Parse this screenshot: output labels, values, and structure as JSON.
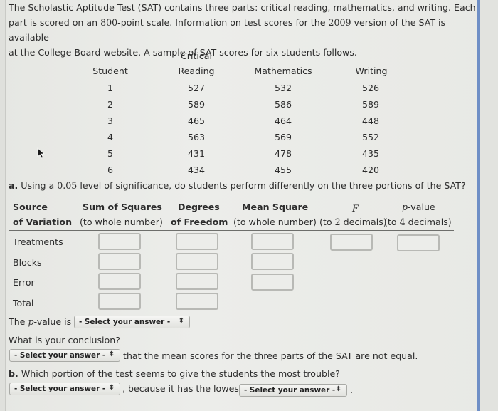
{
  "intro": {
    "line1": "The Scholastic Aptitude Test (SAT) contains three parts: critical reading, mathematics, and writing. Each",
    "line2_a": "part is scored on an ",
    "line2_num": "800",
    "line2_b": "-point scale. Information on test scores for the ",
    "line2_year": "2009",
    "line2_c": " version of the SAT is available",
    "line3": "at the College Board website. A sample of SAT scores for six students follows."
  },
  "scores_table": {
    "headers": {
      "student": "Student",
      "reading_top": "Critical",
      "reading_bottom": "Reading",
      "math": "Mathematics",
      "writing": "Writing"
    },
    "rows": [
      {
        "student": "1",
        "reading": "527",
        "math": "532",
        "writing": "526"
      },
      {
        "student": "2",
        "reading": "589",
        "math": "586",
        "writing": "589"
      },
      {
        "student": "3",
        "reading": "465",
        "math": "464",
        "writing": "448"
      },
      {
        "student": "4",
        "reading": "563",
        "math": "569",
        "writing": "552"
      },
      {
        "student": "5",
        "reading": "431",
        "math": "478",
        "writing": "435"
      },
      {
        "student": "6",
        "reading": "434",
        "math": "455",
        "writing": "420"
      }
    ]
  },
  "part_a": {
    "label": "a.",
    "text_before": " Using a ",
    "alpha": "0.05",
    "text_after": " level of significance, do students perform differently on the three portions of the SAT?"
  },
  "anova": {
    "headers": {
      "source_1": "Source",
      "source_2": "of Variation",
      "ss_1": "Sum of Squares",
      "ss_2": "(to whole number)",
      "df_1": "Degrees",
      "df_2": "of Freedom",
      "ms_1": "Mean Square",
      "ms_2": "(to whole number)",
      "f_1": "F",
      "f_2a": "(to ",
      "f_2num": "2",
      "f_2b": " decimals)",
      "p_1a": "p",
      "p_1b": "-value",
      "p_2a": "(to ",
      "p_2num": "4",
      "p_2b": " decimals)"
    },
    "rows": [
      {
        "label": "Treatments",
        "ss": "",
        "df": "",
        "ms": "",
        "f": "",
        "p": ""
      },
      {
        "label": "Blocks",
        "ss": "",
        "df": "",
        "ms": ""
      },
      {
        "label": "Error",
        "ss": "",
        "df": "",
        "ms": ""
      },
      {
        "label": "Total",
        "ss": "",
        "df": ""
      }
    ]
  },
  "pvalue_q": {
    "text_a": "The ",
    "p": "p",
    "text_b": "-value is",
    "select": "- Select your answer -"
  },
  "conclusion_q": {
    "question": "What is your conclusion?",
    "select": "- Select your answer -",
    "text": "that the mean scores for the three parts of the SAT are not equal."
  },
  "part_b": {
    "label": "b.",
    "question": " Which portion of the test seems to give the students the most trouble?",
    "select1": "- Select your answer -",
    "text": ", because it has the lowest",
    "select2": "- Select your answer -",
    "period": "."
  },
  "icons": {
    "select_arrow": "⬍"
  },
  "colors": {
    "right_border": "#6f8fc6",
    "input_border": "#b8b9b5"
  }
}
